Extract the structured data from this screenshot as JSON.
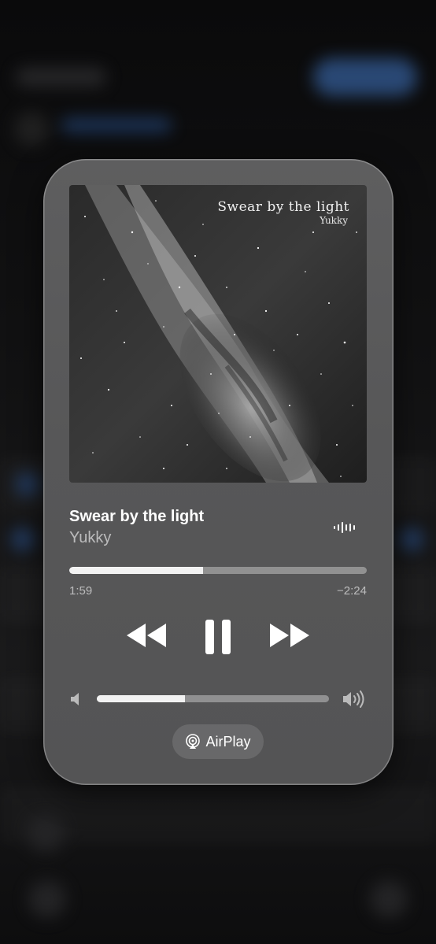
{
  "now_playing": {
    "artwork": {
      "title": "Swear by the light",
      "artist": "Yukky"
    },
    "song_title": "Swear by the light",
    "artist": "Yukky",
    "progress": 0.45,
    "elapsed": "1:59",
    "remaining": "−2:24",
    "volume": 0.38,
    "airplay_label": "AirPlay",
    "icons": {
      "waveform": "waveform-icon",
      "rewind": "rewind-icon",
      "pause": "pause-icon",
      "forward": "fast-forward-icon",
      "volume_low": "speaker-low-icon",
      "volume_high": "speaker-high-icon",
      "airplay": "airplay-icon"
    },
    "colors": {
      "card": "#575758",
      "text_primary": "#ffffff",
      "text_secondary": "#a9a9aa"
    }
  }
}
